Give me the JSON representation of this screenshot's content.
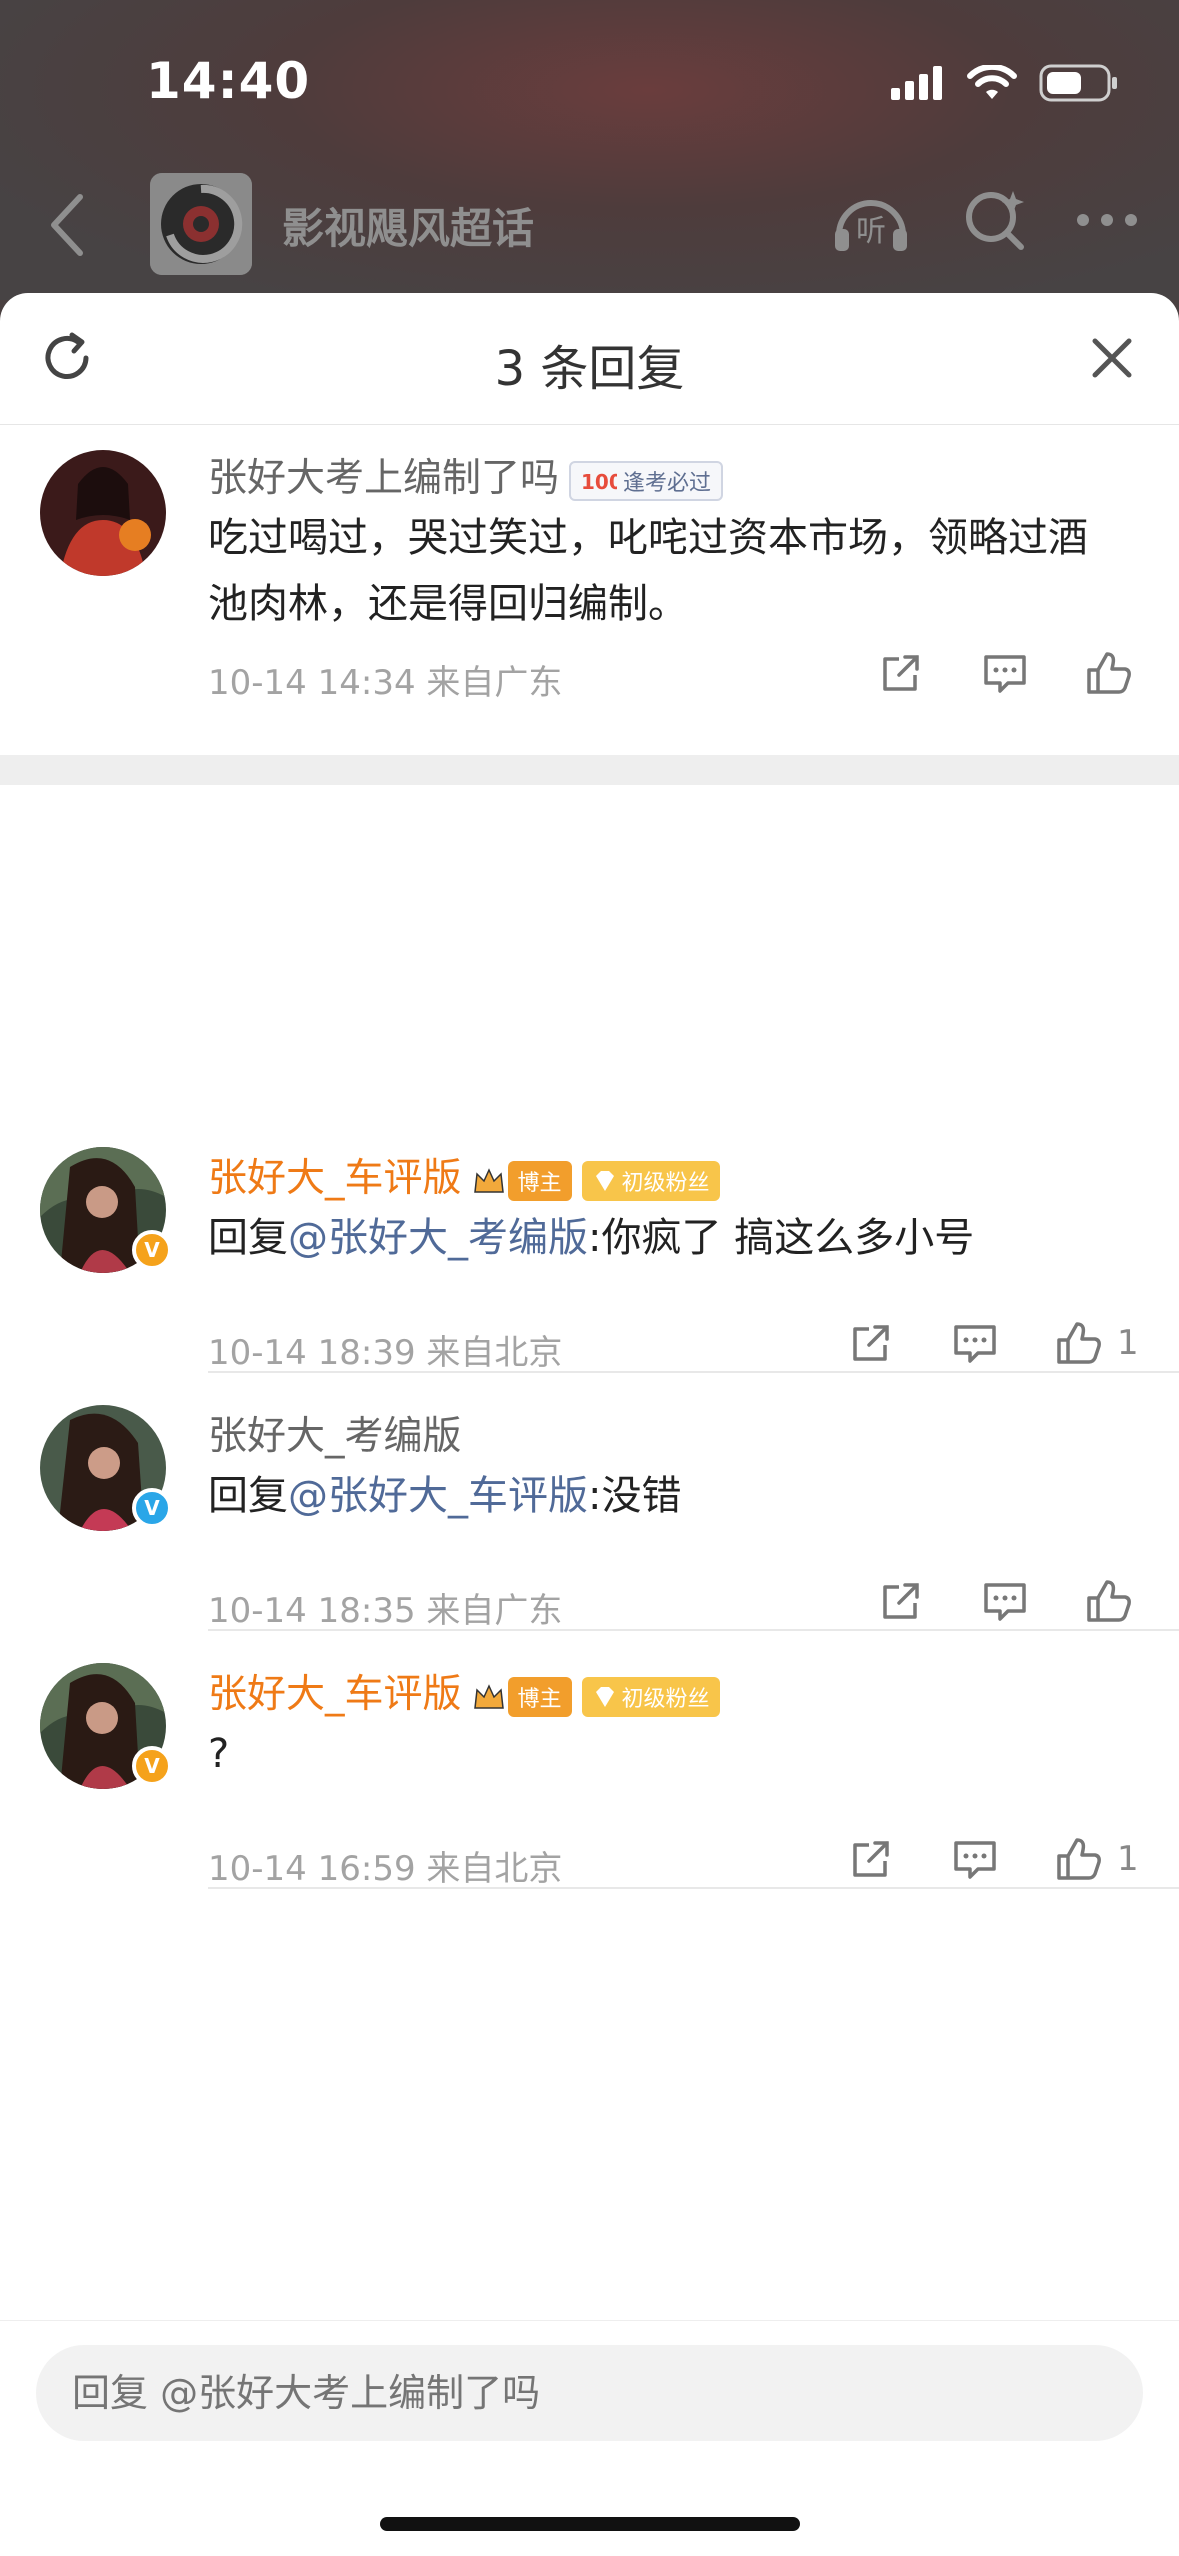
{
  "status": {
    "time": "14:40"
  },
  "nav": {
    "topic_name": "影视飓风超话"
  },
  "sheet": {
    "title": "3 条回复"
  },
  "root_comment": {
    "name": "张好大考上编制了吗",
    "tag": "逢考必过",
    "text": "吃过喝过，哭过笑过，叱咤过资本市场，领略过酒池肉林，还是得回归编制。",
    "meta": "10-14 14:34 来自广东"
  },
  "replies": [
    {
      "name": "张好大_车评版",
      "tag_blogger": "博主",
      "tag_fan": "初级粉丝",
      "reply_prefix": "回复",
      "mention": "@张好大_考编版",
      "text": ":你疯了 搞这么多小号",
      "meta": "10-14 18:39 来自北京",
      "likes": "1"
    },
    {
      "name": "张好大_考编版",
      "reply_prefix": "回复",
      "mention": "@张好大_车评版",
      "text": ":没错",
      "meta": "10-14 18:35 来自广东",
      "likes": ""
    },
    {
      "name": "张好大_车评版",
      "tag_blogger": "博主",
      "tag_fan": "初级粉丝",
      "text": "?",
      "meta": "10-14 16:59 来自北京",
      "likes": "1"
    }
  ],
  "badge_glyph": "V",
  "input": {
    "placeholder": "回复 @张好大考上编制了吗"
  },
  "colors": {
    "accent_orange": "#ef7a16",
    "mention_blue": "#506a98"
  },
  "icons": [
    "back-icon",
    "listen-icon",
    "search-icon",
    "more-icon",
    "refresh-icon",
    "close-icon",
    "share-icon",
    "comment-icon",
    "like-icon"
  ]
}
